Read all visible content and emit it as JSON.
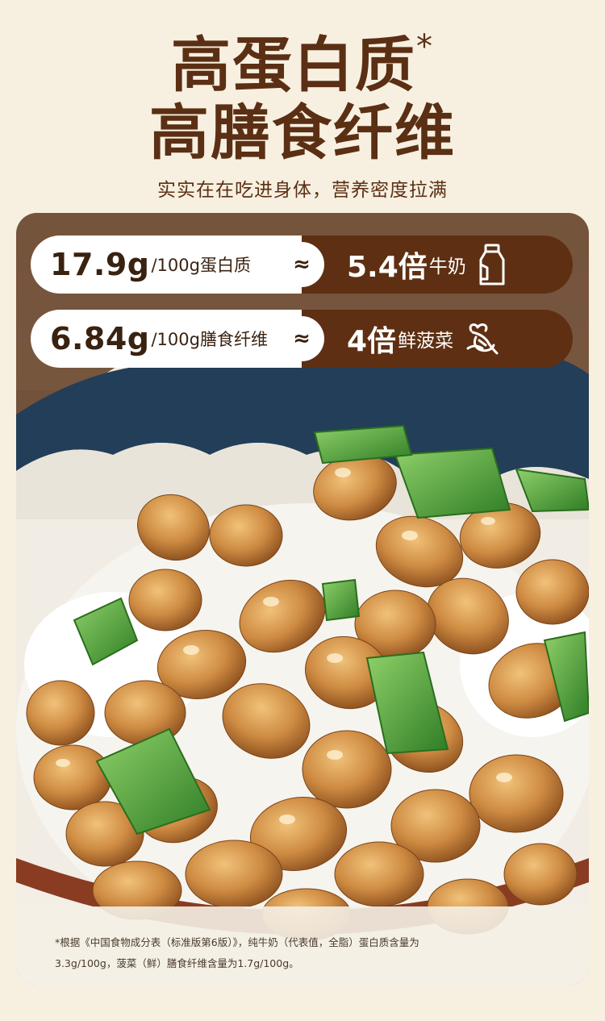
{
  "header": {
    "title_line1": "高蛋白质",
    "title_mark": "*",
    "title_line2": "高膳食纤维",
    "subtitle": "实实在在吃进身体，营养密度拉满"
  },
  "comparisons": [
    {
      "amount": "17.9g",
      "unit": "/100g蛋白质",
      "approx": "≈",
      "ratio": "5.4倍",
      "item": "牛奶",
      "icon": "milk-bottle-icon"
    },
    {
      "amount": "6.84g",
      "unit": "/100g膳食纤维",
      "approx": "≈",
      "ratio": "4倍",
      "item": "鲜菠菜",
      "icon": "spinach-leaf-icon"
    }
  ],
  "footnote": {
    "line1": "*根据《中国食物成分表（标准版第6版）》，纯牛奶（代表值，全脂）蛋白质含量为",
    "line2": "3.3g/100g，菠菜（鲜）膳食纤维含量为1.7g/100g。"
  },
  "colors": {
    "background": "#f7f0e1",
    "brown": "#5e2f12",
    "title_brown": "#5b2f14",
    "bean": "#c98a45",
    "scallion": "#5aa83a"
  }
}
